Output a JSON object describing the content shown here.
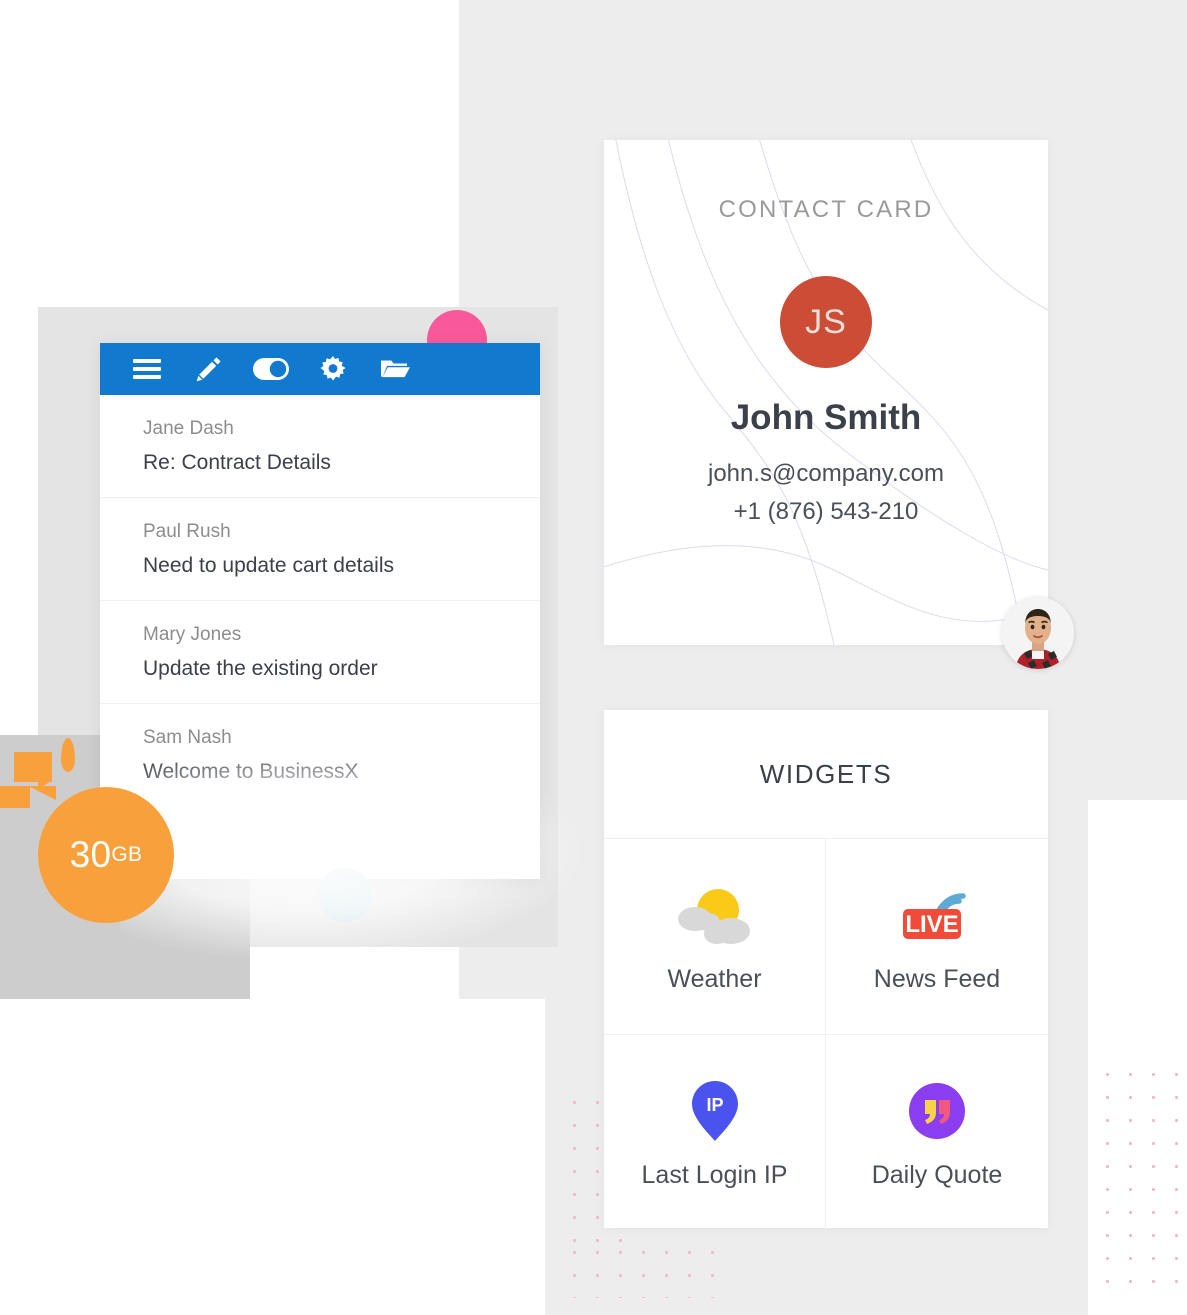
{
  "colors": {
    "toolbar_blue": "#1179ce",
    "accent_orange": "#f8a13c",
    "accent_pink": "#f9599a",
    "accent_lightblue": "#cde3e9",
    "avatar_red": "#cc4c36",
    "dot_pink": "#f6b8c8",
    "page_grey": "#ededed",
    "text_dark": "#3c4049",
    "text_muted": "#8d8d8d"
  },
  "storage_badge": {
    "amount": "30",
    "unit": "GB"
  },
  "mail_app": {
    "toolbar": {
      "buttons": [
        {
          "name": "menu-icon",
          "label": "Menu"
        },
        {
          "name": "edit-pencil-icon",
          "label": "Compose"
        },
        {
          "name": "toggle-switch-icon",
          "label": "Toggle"
        },
        {
          "name": "gear-icon",
          "label": "Settings"
        },
        {
          "name": "folder-open-icon",
          "label": "Folders"
        }
      ]
    },
    "messages": [
      {
        "from": "Jane Dash",
        "subject": "Re: Contract Details"
      },
      {
        "from": "Paul Rush",
        "subject": "Need to update cart details"
      },
      {
        "from": "Mary Jones",
        "subject": "Update the existing order"
      },
      {
        "from": "Sam Nash",
        "subject": "Welcome to BusinessX"
      }
    ]
  },
  "contact_card": {
    "title": "CONTACT CARD",
    "initials": "JS",
    "name": "John Smith",
    "email": "john.s@company.com",
    "phone": "+1 (876) 543-210"
  },
  "widgets_card": {
    "title": "WIDGETS",
    "items": [
      {
        "label": "Weather",
        "icon": "sun-behind-cloud-icon"
      },
      {
        "label": "News Feed",
        "icon": "live-broadcast-icon"
      },
      {
        "label": "Last Login IP",
        "icon": "map-pin-ip-icon"
      },
      {
        "label": "Daily Quote",
        "icon": "quotation-mark-icon"
      }
    ]
  }
}
